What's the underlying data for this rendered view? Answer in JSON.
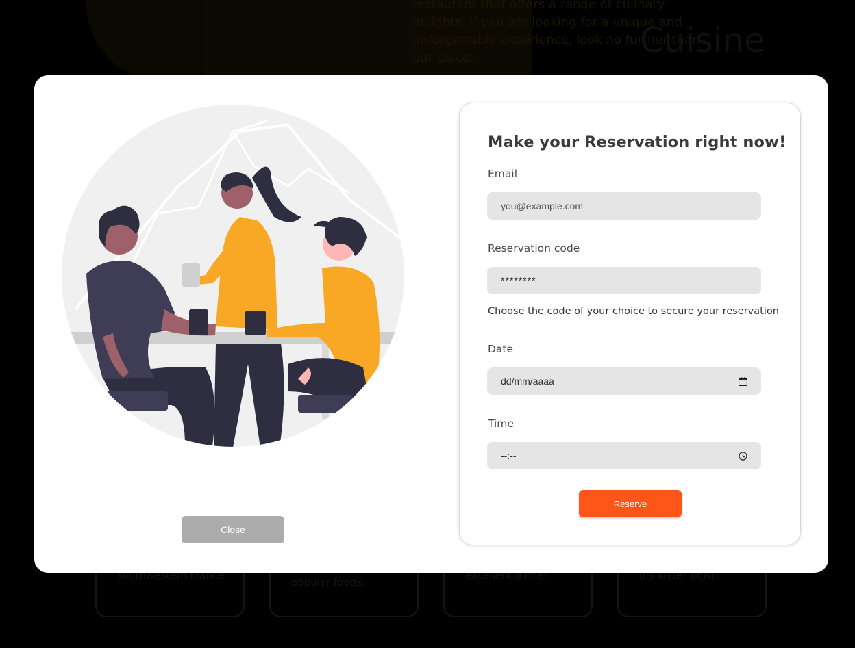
{
  "background": {
    "intro_text": "restaurant that offers a range of culinary delights. If you are looking for a unique and unforgettable experience, look no further than our place.",
    "section_heading": "Cuisine",
    "cards": [
      "southwestern France",
      "popular foods.",
      "excellent dinner",
      "it's water bowl"
    ]
  },
  "modal": {
    "close_label": "Close",
    "form": {
      "title": "Make your Reservation right now!",
      "email": {
        "label": "Email",
        "placeholder": "you@example.com"
      },
      "code": {
        "label": "Reservation code",
        "value": "********",
        "helper": "Choose the code of your choice to secure your reservation"
      },
      "date": {
        "label": "Date",
        "value": "dd/mm/aaaa",
        "icon": "calendar-icon"
      },
      "time": {
        "label": "Time",
        "value": "--:--",
        "icon": "clock-icon"
      },
      "submit_label": "Reserve"
    }
  },
  "colors": {
    "accent": "#fe5618",
    "close_button": "#acacac",
    "input_bg": "#e5e5e5",
    "illustration_yellow": "#f9a826",
    "illustration_dark": "#2f2e41"
  }
}
